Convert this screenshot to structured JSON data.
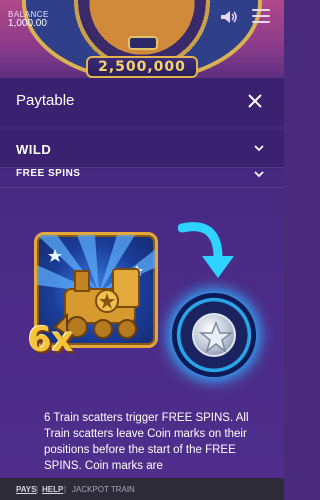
{
  "game": {
    "balance_label": "BALANCE",
    "balance_value": "1,000.00",
    "jackpot_value": "2,500,000",
    "sound_icon": "speaker-icon",
    "menu_icon": "hamburger-icon"
  },
  "paytable": {
    "title": "Paytable",
    "close_icon": "close-icon",
    "sections": [
      {
        "label": "WILD",
        "icon": "chevron-down-icon"
      },
      {
        "label": "FREE SPINS",
        "icon": "chevron-down-icon"
      }
    ],
    "multiplier": "6x",
    "description": "6 Train scatters trigger FREE SPINS. All Train scatters leave Coin marks on their positions before the start of the FREE SPINS. Coin marks are"
  },
  "bottom_nav": {
    "pays": "PAYS",
    "separator": "|",
    "help": "HELP",
    "jackpot": "JACKPOT TRAIN"
  },
  "colors": {
    "overlay": "#4a2b86",
    "header": "#3a2270",
    "gold": "#f6c43a",
    "cyan_arrow": "#2fd3ff"
  }
}
